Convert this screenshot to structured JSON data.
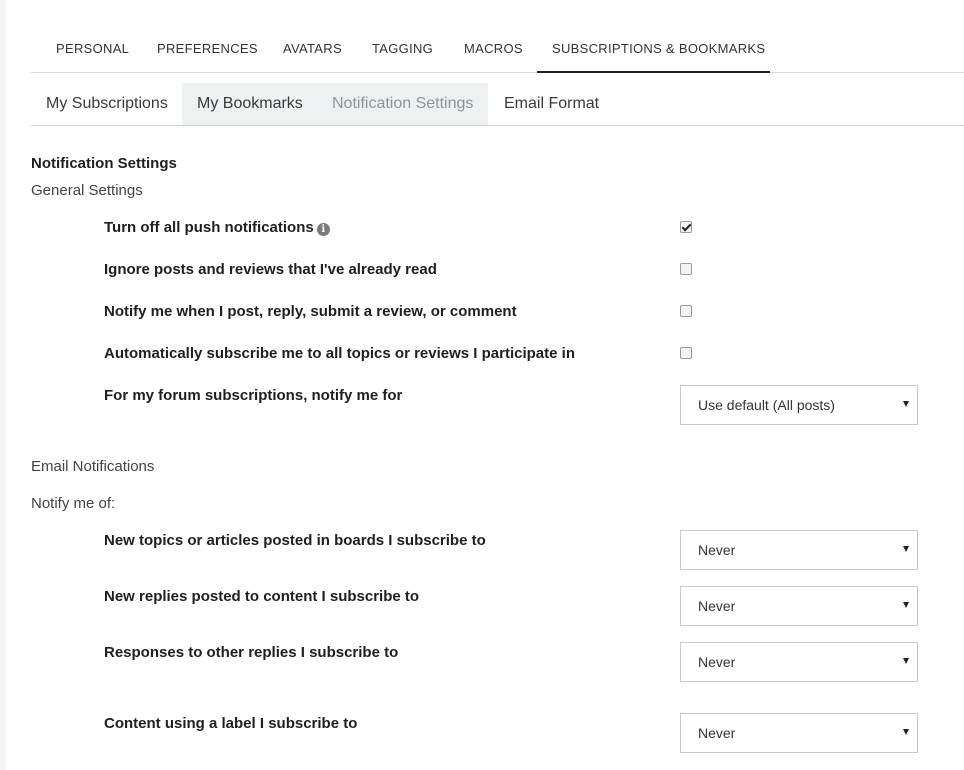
{
  "top_tabs": [
    {
      "label": "PERSONAL"
    },
    {
      "label": "PREFERENCES"
    },
    {
      "label": "AVATARS"
    },
    {
      "label": "TAGGING"
    },
    {
      "label": "MACROS"
    },
    {
      "label": "SUBSCRIPTIONS & BOOKMARKS",
      "active": true
    }
  ],
  "sub_tabs": [
    {
      "label": "My Subscriptions"
    },
    {
      "label": "My Bookmarks"
    },
    {
      "label": "Notification Settings",
      "active": true
    },
    {
      "label": "Email Format"
    }
  ],
  "notification": {
    "title": "Notification Settings",
    "general_heading": "General Settings",
    "rows": [
      {
        "label": "Turn off all push notifications",
        "checked": true,
        "icon": "info-icon"
      },
      {
        "label": "Ignore posts and reviews that I've already read",
        "checked": false
      },
      {
        "label": "Notify me when I post, reply, submit a review, or comment",
        "checked": false
      },
      {
        "label": "Automatically subscribe me to all topics or reviews I participate in",
        "checked": false
      }
    ],
    "forum_row": {
      "label": "For my forum subscriptions, notify me for",
      "value": "Use default (All posts)"
    }
  },
  "email": {
    "heading": "Email Notifications",
    "notify_me_of": "Notify me of:",
    "rows": [
      {
        "bold": "New topics or articles",
        "rest": " posted in boards I subscribe to",
        "value": "Never"
      },
      {
        "bold": "New replies",
        "rest": " posted to content I subscribe to",
        "value": "Never"
      },
      {
        "bold": "Responses to other replies",
        "rest": " I subscribe to",
        "value": "Never"
      },
      {
        "bold_pre": "Content using a ",
        "bold": "label",
        "rest": " I subscribe to",
        "value": "Never"
      }
    ]
  },
  "colors": {
    "active_underline": "#1f1f1f",
    "subtab_bg": "#eef1f1"
  }
}
